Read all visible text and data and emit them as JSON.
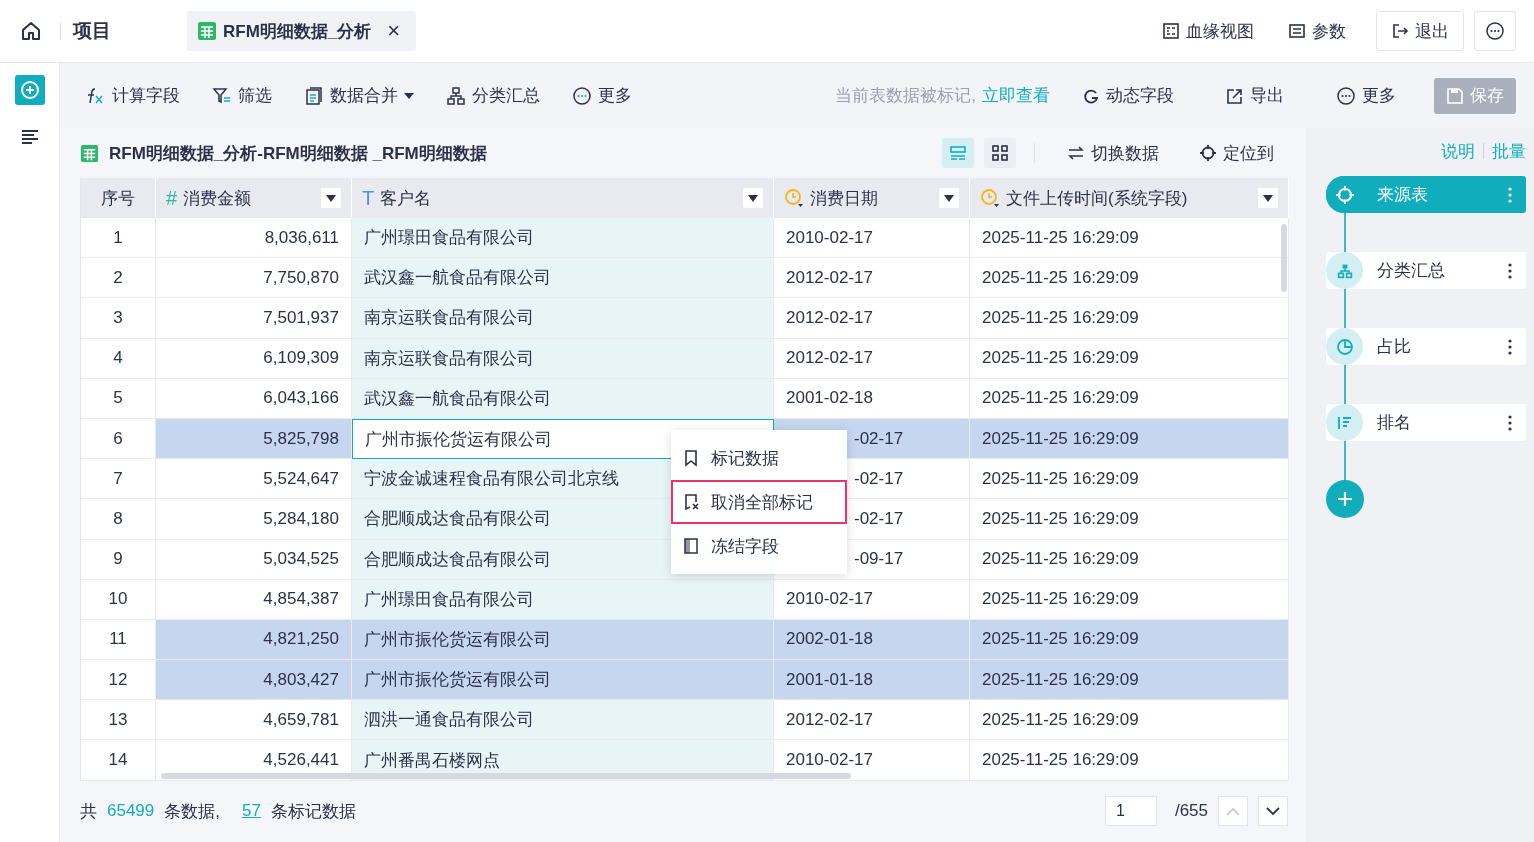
{
  "topbar": {
    "title": "项目",
    "tab": {
      "label": "RFM明细数据_分析",
      "close": "×"
    },
    "actions": [
      {
        "label": "血缘视图",
        "kind": "lineage"
      },
      {
        "label": "参数",
        "kind": "params"
      },
      {
        "label": "退出",
        "kind": "exit"
      }
    ]
  },
  "toolbar": {
    "left": [
      {
        "label": "计算字段",
        "kind": "fx",
        "dropdown": false
      },
      {
        "label": "筛选",
        "kind": "filter",
        "dropdown": false
      },
      {
        "label": "数据合并",
        "kind": "merge",
        "dropdown": true
      },
      {
        "label": "分类汇总",
        "kind": "group",
        "dropdown": false
      },
      {
        "label": "更多",
        "kind": "more",
        "dropdown": false
      }
    ],
    "notice": "当前表数据被标记,",
    "notice_link": "立即查看",
    "right": [
      {
        "label": "动态字段",
        "kind": "dynamic"
      },
      {
        "label": "导出",
        "kind": "export"
      },
      {
        "label": "更多",
        "kind": "more"
      }
    ],
    "save": {
      "label": "保存",
      "disabled": true
    }
  },
  "table_title": "RFM明细数据_分析-RFM明细数据 _RFM明细数据",
  "view_modes": [
    {
      "kind": "list",
      "selected": true
    },
    {
      "kind": "grid",
      "selected": false
    }
  ],
  "table_actions": [
    {
      "label": "切换数据",
      "kind": "switch"
    },
    {
      "label": "定位到",
      "kind": "locate"
    }
  ],
  "table": {
    "columns": [
      {
        "label": "序号",
        "kind": "index"
      },
      {
        "label": "消费金额",
        "kind": "number",
        "glyph": "#"
      },
      {
        "label": "客户名",
        "kind": "text",
        "glyph": "T"
      },
      {
        "label": "消费日期",
        "kind": "date"
      },
      {
        "label": "文件上传时间(系统字段)",
        "kind": "date"
      }
    ],
    "rows": [
      {
        "index": "1",
        "amount": "8,036,611",
        "customer": "广州璟田食品有限公司",
        "date": "2010-02-17",
        "uploaded": "2025-11-25 16:29:09",
        "marked": false,
        "active": false,
        "covered": false
      },
      {
        "index": "2",
        "amount": "7,750,870",
        "customer": "武汉鑫一航食品有限公司",
        "date": "2012-02-17",
        "uploaded": "2025-11-25 16:29:09",
        "marked": false,
        "active": false,
        "covered": false
      },
      {
        "index": "3",
        "amount": "7,501,937",
        "customer": "南京运联食品有限公司",
        "date": "2012-02-17",
        "uploaded": "2025-11-25 16:29:09",
        "marked": false,
        "active": false,
        "covered": false
      },
      {
        "index": "4",
        "amount": "6,109,309",
        "customer": "南京运联食品有限公司",
        "date": "2012-02-17",
        "uploaded": "2025-11-25 16:29:09",
        "marked": false,
        "active": false,
        "covered": false
      },
      {
        "index": "5",
        "amount": "6,043,166",
        "customer": "武汉鑫一航食品有限公司",
        "date": "2001-02-18",
        "uploaded": "2025-11-25 16:29:09",
        "marked": false,
        "active": false,
        "covered": false
      },
      {
        "index": "6",
        "amount": "5,825,798",
        "customer": "广州市振伦货运有限公司",
        "date": "-02-17",
        "uploaded": "2025-11-25 16:29:09",
        "marked": true,
        "active": true,
        "covered": true
      },
      {
        "index": "7",
        "amount": "5,524,647",
        "customer": "宁波金诚速程食品有限公司北京线",
        "date": "-02-17",
        "uploaded": "2025-11-25 16:29:09",
        "marked": false,
        "active": false,
        "covered": true
      },
      {
        "index": "8",
        "amount": "5,284,180",
        "customer": "合肥顺成达食品有限公司",
        "date": "-02-17",
        "uploaded": "2025-11-25 16:29:09",
        "marked": false,
        "active": false,
        "covered": true
      },
      {
        "index": "9",
        "amount": "5,034,525",
        "customer": "合肥顺成达食品有限公司",
        "date": "-09-17",
        "uploaded": "2025-11-25 16:29:09",
        "marked": false,
        "active": false,
        "covered": true
      },
      {
        "index": "10",
        "amount": "4,854,387",
        "customer": "广州璟田食品有限公司",
        "date": "2010-02-17",
        "uploaded": "2025-11-25 16:29:09",
        "marked": false,
        "active": false,
        "covered": false
      },
      {
        "index": "11",
        "amount": "4,821,250",
        "customer": "广州市振伦货运有限公司",
        "date": "2002-01-18",
        "uploaded": "2025-11-25 16:29:09",
        "marked": true,
        "active": false,
        "covered": false
      },
      {
        "index": "12",
        "amount": "4,803,427",
        "customer": "广州市振伦货运有限公司",
        "date": "2001-01-18",
        "uploaded": "2025-11-25 16:29:09",
        "marked": true,
        "active": false,
        "covered": false
      },
      {
        "index": "13",
        "amount": "4,659,781",
        "customer": "泗洪一通食品有限公司",
        "date": "2012-02-17",
        "uploaded": "2025-11-25 16:29:09",
        "marked": false,
        "active": false,
        "covered": false
      },
      {
        "index": "14",
        "amount": "4,526,441",
        "customer": "广州番禺石楼网点",
        "date": "2010-02-17",
        "uploaded": "2025-11-25 16:29:09",
        "marked": false,
        "active": false,
        "covered": false
      }
    ]
  },
  "context_menu": {
    "items": [
      {
        "label": "标记数据",
        "kind": "mark",
        "selected": false
      },
      {
        "label": "取消全部标记",
        "kind": "unmark",
        "selected": true
      },
      {
        "label": "冻结字段",
        "kind": "freeze",
        "selected": false
      }
    ]
  },
  "footer": {
    "prefix": "共",
    "total": "65499",
    "total_suffix": "条数据,",
    "marked": "57",
    "marked_suffix": "条标记数据",
    "page": "1",
    "pages": "/655"
  },
  "flow": {
    "links": [
      "说明",
      "批量"
    ],
    "nodes": [
      {
        "label": "来源表",
        "kind": "source",
        "selected": true
      },
      {
        "label": "分类汇总",
        "kind": "group",
        "selected": false
      },
      {
        "label": "占比",
        "kind": "ratio",
        "selected": false
      },
      {
        "label": "排名",
        "kind": "rank",
        "selected": false
      }
    ]
  }
}
